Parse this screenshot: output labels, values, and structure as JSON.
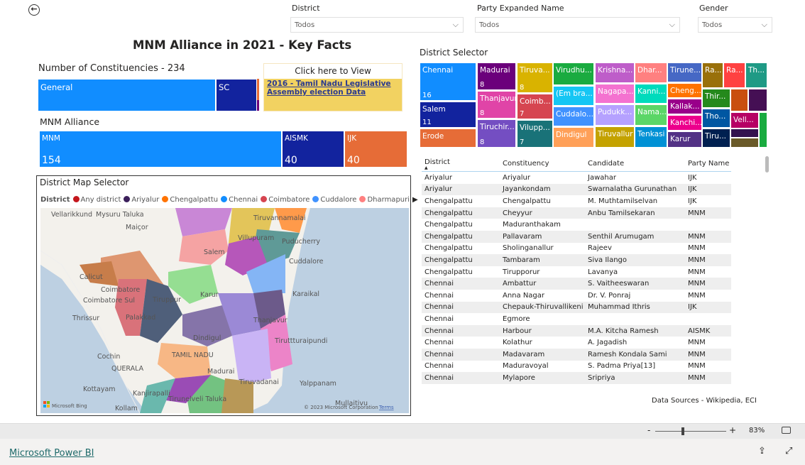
{
  "filters": [
    {
      "label": "District",
      "value": "Todos"
    },
    {
      "label": "Party Expanded Name",
      "value": "Todos"
    },
    {
      "label": "Gender",
      "value": "Todos"
    }
  ],
  "title": "MNM Alliance in 2021 - Key Facts",
  "constituencies": {
    "label": "Number of Constituencies - 234",
    "segments": [
      {
        "name": "General",
        "color": "#118dff"
      },
      {
        "name": "SC",
        "color": "#12239e"
      }
    ]
  },
  "link_card": {
    "header": "Click here to View",
    "link": "2016 - Tamil Nadu Legislative Assembly election Data"
  },
  "alliance": {
    "label": "MNM Alliance",
    "segments": [
      {
        "name": "MNM",
        "value": "154",
        "color": "#118dff"
      },
      {
        "name": "AISMK",
        "value": "40",
        "color": "#12239e"
      },
      {
        "name": "IJK",
        "value": "40",
        "color": "#e66c37"
      }
    ]
  },
  "district_selector": {
    "title": "District Selector",
    "tiles": [
      {
        "name": "Chennai",
        "value": "16"
      },
      {
        "name": "Salem",
        "value": "11"
      },
      {
        "name": "Erode"
      },
      {
        "name": "Madurai",
        "value": "8"
      },
      {
        "name": "Thanjavur",
        "value": "8"
      },
      {
        "name": "Tiruchir...",
        "value": "8"
      },
      {
        "name": "Tiruva...",
        "value": "8"
      },
      {
        "name": "Coimb...",
        "value": "7"
      },
      {
        "name": "Vilupp...",
        "value": "7"
      },
      {
        "name": "Virudhu..."
      },
      {
        "name": "(Em bra..."
      },
      {
        "name": "Cuddalo..."
      },
      {
        "name": "Dindigul"
      },
      {
        "name": "Krishna..."
      },
      {
        "name": "Nagapa..."
      },
      {
        "name": "Pudukk..."
      },
      {
        "name": "Tiruvallur"
      },
      {
        "name": "Dhar..."
      },
      {
        "name": "Kanni..."
      },
      {
        "name": "Nama..."
      },
      {
        "name": "Tenkasi"
      },
      {
        "name": "Tirune..."
      },
      {
        "name": "Cheng..."
      },
      {
        "name": "Kallak..."
      },
      {
        "name": "Kanchi..."
      },
      {
        "name": "Karur"
      },
      {
        "name": "Ra..."
      },
      {
        "name": "Ra..."
      },
      {
        "name": "Th..."
      },
      {
        "name": "Thir..."
      },
      {
        "name": "Tho..."
      },
      {
        "name": "Tiru..."
      },
      {
        "name": "Vell..."
      }
    ]
  },
  "map": {
    "title": "District Map Selector",
    "legend_title": "District",
    "legend": [
      {
        "name": "Any district",
        "color": "#c4161c"
      },
      {
        "name": "Ariyalur",
        "color": "#3b1f5a"
      },
      {
        "name": "Chengalpattu",
        "color": "#ff7300"
      },
      {
        "name": "Chennai",
        "color": "#118dff"
      },
      {
        "name": "Coimbatore",
        "color": "#d64550"
      },
      {
        "name": "Cuddalore",
        "color": "#4092ff"
      },
      {
        "name": "Dharmapuri",
        "color": "#ff8080"
      }
    ],
    "places": [
      "Vellarikkund",
      "Mysuru Taluka",
      "Maiçor",
      "Salem",
      "Tiruvannamalai",
      "Villupuram",
      "Puducherry",
      "Cuddalore",
      "Calicut",
      "Coimbatore",
      "Coimbatore Sul",
      "Tiruppur",
      "Karur",
      "Thrissur",
      "Palakkad",
      "Karaikal",
      "Thanjavur",
      "Dindigul",
      "Tiruttturaipundi",
      "Cochin",
      "QUERALA",
      "TAMIL NADU",
      "Madurai",
      "Tiruvadanai",
      "Yalppanam",
      "Kottayam",
      "Kanjirapalli",
      "Mullaitivu",
      "Tirunelveli Taluka",
      "Kollam"
    ],
    "attribution": "© 2023 Microsoft Corporation",
    "terms": "Terms",
    "bing": "Microsoft Bing"
  },
  "table": {
    "columns": [
      "District",
      "Constituency",
      "Candidate",
      "Party Name"
    ],
    "rows": [
      [
        "Ariyalur",
        "Ariyalur",
        "Jawahar",
        "IJK"
      ],
      [
        "Ariyalur",
        "Jayankondam",
        "Swarnalatha Gurunathan",
        "IJK"
      ],
      [
        "Chengalpattu",
        "Chengalpattu",
        "M. Muthtamilselvan",
        "IJK"
      ],
      [
        "Chengalpattu",
        "Cheyyur",
        "Anbu Tamilsekaran",
        "MNM"
      ],
      [
        "Chengalpattu",
        "Maduranthakam",
        "",
        ""
      ],
      [
        "Chengalpattu",
        "Pallavaram",
        "Senthil Arumugam",
        "MNM"
      ],
      [
        "Chengalpattu",
        "Sholinganallur",
        "Rajeev",
        "MNM"
      ],
      [
        "Chengalpattu",
        "Tambaram",
        "Siva Ilango",
        "MNM"
      ],
      [
        "Chengalpattu",
        "Tirupporur",
        "Lavanya",
        "MNM"
      ],
      [
        "Chennai",
        "Ambattur",
        "S. Vaitheeswaran",
        "MNM"
      ],
      [
        "Chennai",
        "Anna Nagar",
        "Dr. V. Ponraj",
        "MNM"
      ],
      [
        "Chennai",
        "Chepauk-Thiruvallikeni",
        "Muhammad Ithris",
        "IJK"
      ],
      [
        "Chennai",
        "Egmore",
        "",
        ""
      ],
      [
        "Chennai",
        "Harbour",
        "M.A. Kitcha Ramesh",
        "AISMK"
      ],
      [
        "Chennai",
        "Kolathur",
        "A. Jagadish",
        "MNM"
      ],
      [
        "Chennai",
        "Madavaram",
        "Ramesh Kondala Sami",
        "MNM"
      ],
      [
        "Chennai",
        "Maduravoyal",
        "S. Padma Priya[13]",
        "MNM"
      ],
      [
        "Chennai",
        "Mylapore",
        "Sripriya",
        "MNM"
      ]
    ]
  },
  "sources": "Data Sources - Wikipedia, ECI",
  "zoom": {
    "level": "83%",
    "minus": "-",
    "plus": "+"
  },
  "footer": {
    "brand": "Microsoft Power BI"
  }
}
